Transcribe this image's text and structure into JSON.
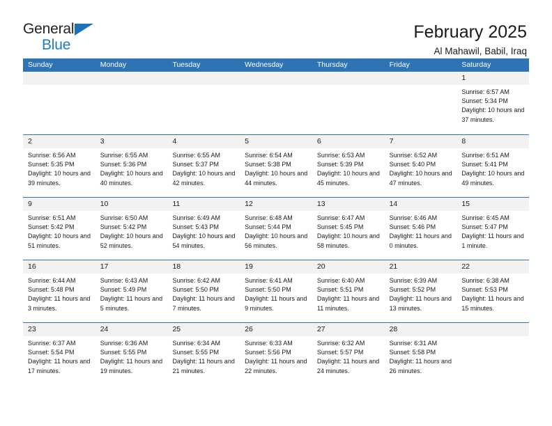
{
  "brand": {
    "name_top": "General",
    "name_bottom": "Blue",
    "triangle_color": "#1f6fb8",
    "text_color": "#231f20",
    "blue_color": "#1f7ac4"
  },
  "header": {
    "month_title": "February 2025",
    "location": "Al Mahawil, Babil, Iraq"
  },
  "theme": {
    "header_bg": "#2e74b5",
    "header_text": "#ffffff",
    "day_band_bg": "#f2f2f2",
    "cell_bg": "#ffffff",
    "text": "#1a1a1a"
  },
  "weekdays": [
    "Sunday",
    "Monday",
    "Tuesday",
    "Wednesday",
    "Thursday",
    "Friday",
    "Saturday"
  ],
  "weeks": [
    [
      {
        "day": "",
        "empty": true
      },
      {
        "day": "",
        "empty": true
      },
      {
        "day": "",
        "empty": true
      },
      {
        "day": "",
        "empty": true
      },
      {
        "day": "",
        "empty": true
      },
      {
        "day": "",
        "empty": true
      },
      {
        "day": "1",
        "sunrise": "Sunrise: 6:57 AM",
        "sunset": "Sunset: 5:34 PM",
        "daylight": "Daylight: 10 hours and 37 minutes."
      }
    ],
    [
      {
        "day": "2",
        "sunrise": "Sunrise: 6:56 AM",
        "sunset": "Sunset: 5:35 PM",
        "daylight": "Daylight: 10 hours and 39 minutes."
      },
      {
        "day": "3",
        "sunrise": "Sunrise: 6:55 AM",
        "sunset": "Sunset: 5:36 PM",
        "daylight": "Daylight: 10 hours and 40 minutes."
      },
      {
        "day": "4",
        "sunrise": "Sunrise: 6:55 AM",
        "sunset": "Sunset: 5:37 PM",
        "daylight": "Daylight: 10 hours and 42 minutes."
      },
      {
        "day": "5",
        "sunrise": "Sunrise: 6:54 AM",
        "sunset": "Sunset: 5:38 PM",
        "daylight": "Daylight: 10 hours and 44 minutes."
      },
      {
        "day": "6",
        "sunrise": "Sunrise: 6:53 AM",
        "sunset": "Sunset: 5:39 PM",
        "daylight": "Daylight: 10 hours and 45 minutes."
      },
      {
        "day": "7",
        "sunrise": "Sunrise: 6:52 AM",
        "sunset": "Sunset: 5:40 PM",
        "daylight": "Daylight: 10 hours and 47 minutes."
      },
      {
        "day": "8",
        "sunrise": "Sunrise: 6:51 AM",
        "sunset": "Sunset: 5:41 PM",
        "daylight": "Daylight: 10 hours and 49 minutes."
      }
    ],
    [
      {
        "day": "9",
        "sunrise": "Sunrise: 6:51 AM",
        "sunset": "Sunset: 5:42 PM",
        "daylight": "Daylight: 10 hours and 51 minutes."
      },
      {
        "day": "10",
        "sunrise": "Sunrise: 6:50 AM",
        "sunset": "Sunset: 5:42 PM",
        "daylight": "Daylight: 10 hours and 52 minutes."
      },
      {
        "day": "11",
        "sunrise": "Sunrise: 6:49 AM",
        "sunset": "Sunset: 5:43 PM",
        "daylight": "Daylight: 10 hours and 54 minutes."
      },
      {
        "day": "12",
        "sunrise": "Sunrise: 6:48 AM",
        "sunset": "Sunset: 5:44 PM",
        "daylight": "Daylight: 10 hours and 56 minutes."
      },
      {
        "day": "13",
        "sunrise": "Sunrise: 6:47 AM",
        "sunset": "Sunset: 5:45 PM",
        "daylight": "Daylight: 10 hours and 58 minutes."
      },
      {
        "day": "14",
        "sunrise": "Sunrise: 6:46 AM",
        "sunset": "Sunset: 5:46 PM",
        "daylight": "Daylight: 11 hours and 0 minutes."
      },
      {
        "day": "15",
        "sunrise": "Sunrise: 6:45 AM",
        "sunset": "Sunset: 5:47 PM",
        "daylight": "Daylight: 11 hours and 1 minute."
      }
    ],
    [
      {
        "day": "16",
        "sunrise": "Sunrise: 6:44 AM",
        "sunset": "Sunset: 5:48 PM",
        "daylight": "Daylight: 11 hours and 3 minutes."
      },
      {
        "day": "17",
        "sunrise": "Sunrise: 6:43 AM",
        "sunset": "Sunset: 5:49 PM",
        "daylight": "Daylight: 11 hours and 5 minutes."
      },
      {
        "day": "18",
        "sunrise": "Sunrise: 6:42 AM",
        "sunset": "Sunset: 5:50 PM",
        "daylight": "Daylight: 11 hours and 7 minutes."
      },
      {
        "day": "19",
        "sunrise": "Sunrise: 6:41 AM",
        "sunset": "Sunset: 5:50 PM",
        "daylight": "Daylight: 11 hours and 9 minutes."
      },
      {
        "day": "20",
        "sunrise": "Sunrise: 6:40 AM",
        "sunset": "Sunset: 5:51 PM",
        "daylight": "Daylight: 11 hours and 11 minutes."
      },
      {
        "day": "21",
        "sunrise": "Sunrise: 6:39 AM",
        "sunset": "Sunset: 5:52 PM",
        "daylight": "Daylight: 11 hours and 13 minutes."
      },
      {
        "day": "22",
        "sunrise": "Sunrise: 6:38 AM",
        "sunset": "Sunset: 5:53 PM",
        "daylight": "Daylight: 11 hours and 15 minutes."
      }
    ],
    [
      {
        "day": "23",
        "sunrise": "Sunrise: 6:37 AM",
        "sunset": "Sunset: 5:54 PM",
        "daylight": "Daylight: 11 hours and 17 minutes."
      },
      {
        "day": "24",
        "sunrise": "Sunrise: 6:36 AM",
        "sunset": "Sunset: 5:55 PM",
        "daylight": "Daylight: 11 hours and 19 minutes."
      },
      {
        "day": "25",
        "sunrise": "Sunrise: 6:34 AM",
        "sunset": "Sunset: 5:55 PM",
        "daylight": "Daylight: 11 hours and 21 minutes."
      },
      {
        "day": "26",
        "sunrise": "Sunrise: 6:33 AM",
        "sunset": "Sunset: 5:56 PM",
        "daylight": "Daylight: 11 hours and 22 minutes."
      },
      {
        "day": "27",
        "sunrise": "Sunrise: 6:32 AM",
        "sunset": "Sunset: 5:57 PM",
        "daylight": "Daylight: 11 hours and 24 minutes."
      },
      {
        "day": "28",
        "sunrise": "Sunrise: 6:31 AM",
        "sunset": "Sunset: 5:58 PM",
        "daylight": "Daylight: 11 hours and 26 minutes."
      },
      {
        "day": "",
        "empty": true
      }
    ]
  ]
}
